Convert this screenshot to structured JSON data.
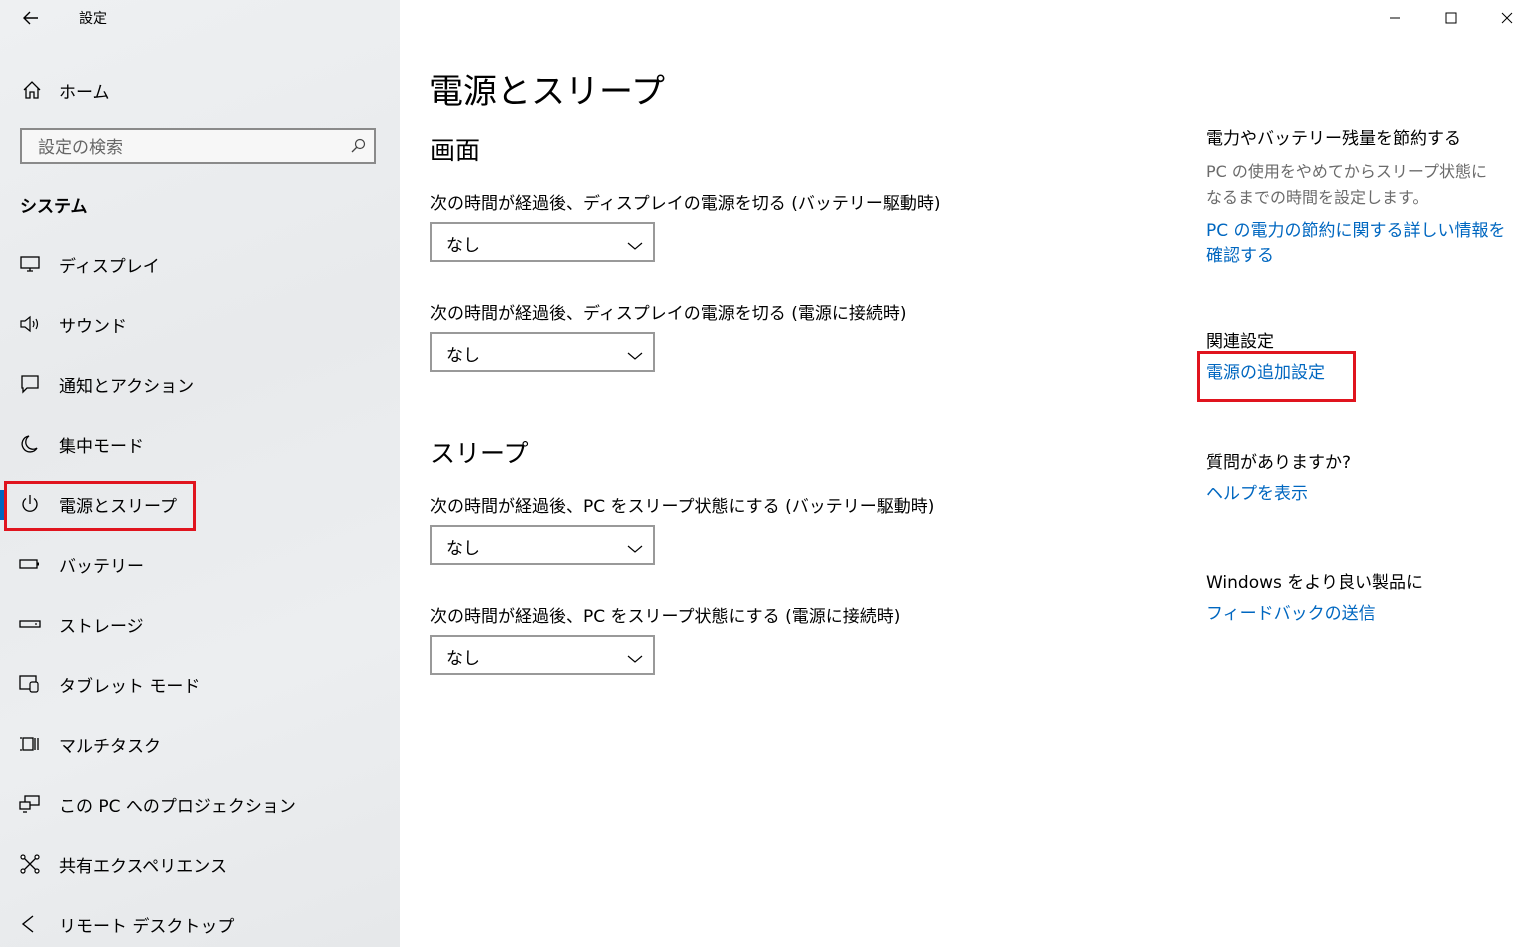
{
  "window": {
    "title": "設定",
    "controls": {
      "minimize_icon": "minimize-icon",
      "maximize_icon": "maximize-icon",
      "close_icon": "close-icon"
    }
  },
  "sidebar": {
    "home_label": "ホーム",
    "search": {
      "placeholder": "設定の検索",
      "value": ""
    },
    "section": "システム",
    "items": [
      {
        "label": "ディスプレイ",
        "icon": "display-icon"
      },
      {
        "label": "サウンド",
        "icon": "speaker-icon"
      },
      {
        "label": "通知とアクション",
        "icon": "notification-icon"
      },
      {
        "label": "集中モード",
        "icon": "moon-icon"
      },
      {
        "label": "電源とスリープ",
        "icon": "power-icon",
        "active": true,
        "highlighted": true
      },
      {
        "label": "バッテリー",
        "icon": "battery-icon"
      },
      {
        "label": "ストレージ",
        "icon": "storage-icon"
      },
      {
        "label": "タブレット モード",
        "icon": "tablet-icon"
      },
      {
        "label": "マルチタスク",
        "icon": "multitask-icon"
      },
      {
        "label": "この PC へのプロジェクション",
        "icon": "projection-icon"
      },
      {
        "label": "共有エクスペリエンス",
        "icon": "shared-icon"
      },
      {
        "label": "リモート デスクトップ",
        "icon": "remote-icon"
      }
    ]
  },
  "main": {
    "title": "電源とスリープ",
    "screen": {
      "heading": "画面",
      "battery_label": "次の時間が経過後、ディスプレイの電源を切る (バッテリー駆動時)",
      "battery_value": "なし",
      "plugged_label": "次の時間が経過後、ディスプレイの電源を切る (電源に接続時)",
      "plugged_value": "なし"
    },
    "sleep": {
      "heading": "スリープ",
      "battery_label": "次の時間が経過後、PC をスリープ状態にする (バッテリー駆動時)",
      "battery_value": "なし",
      "plugged_label": "次の時間が経過後、PC をスリープ状態にする (電源に接続時)",
      "plugged_value": "なし"
    }
  },
  "right": {
    "save": {
      "heading": "電力やバッテリー残量を節約する",
      "desc": "PC の使用をやめてからスリープ状態になるまでの時間を設定します。",
      "link": "PC の電力の節約に関する詳しい情報を確認する"
    },
    "related": {
      "heading": "関連設定",
      "link": "電源の追加設定",
      "highlighted": true
    },
    "help": {
      "heading": "質問がありますか?",
      "link": "ヘルプを表示"
    },
    "feedback": {
      "heading": "Windows をより良い製品に",
      "link": "フィードバックの送信"
    }
  },
  "colors": {
    "accent": "#0067c0",
    "highlight": "#e0141e",
    "sidebar_bg": "#eceef0"
  }
}
